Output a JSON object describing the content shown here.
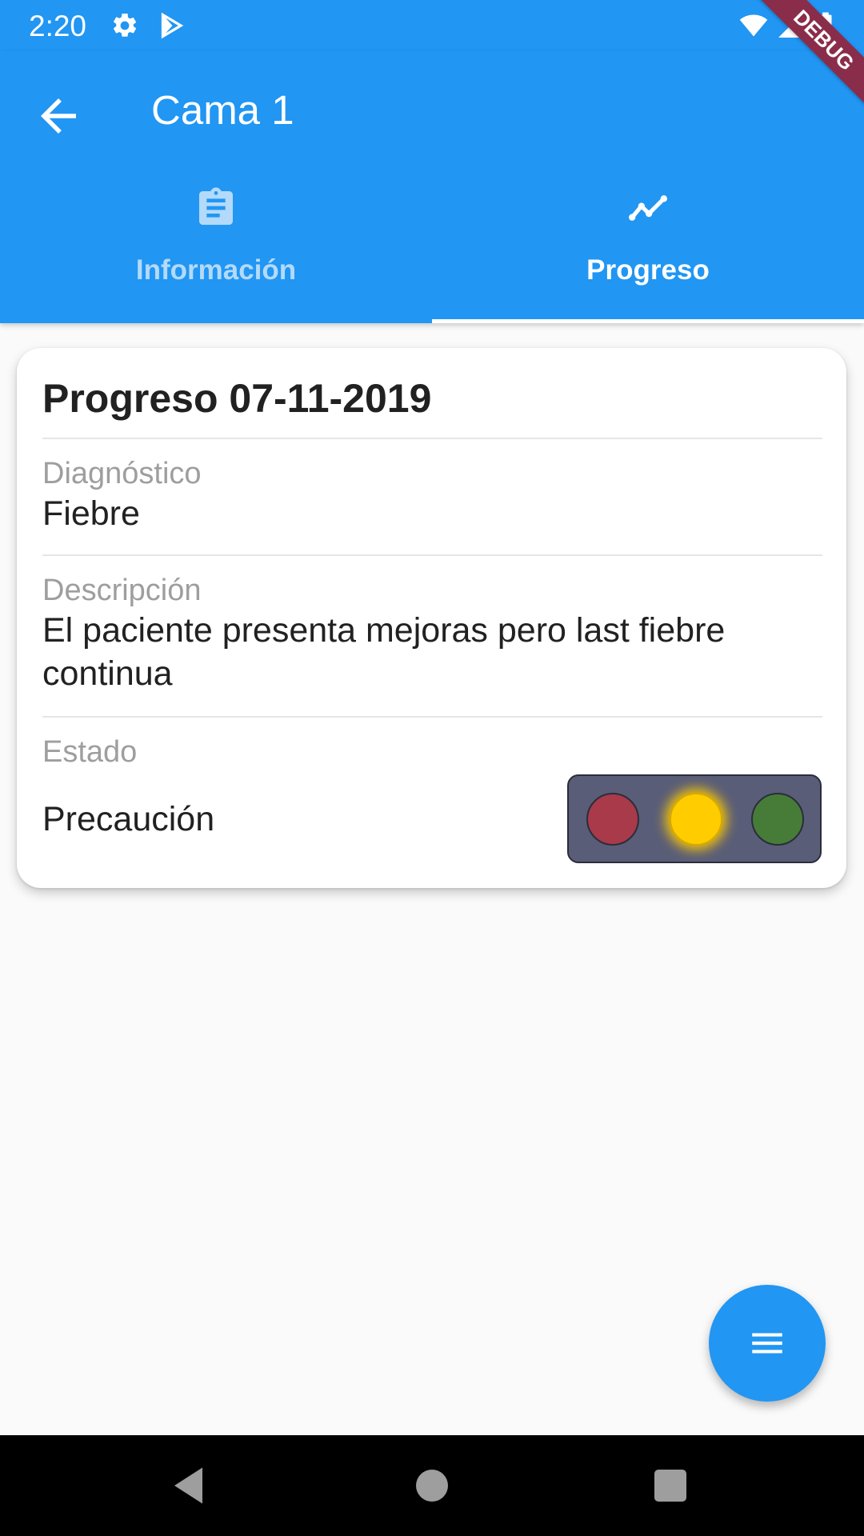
{
  "status_bar": {
    "time": "2:20",
    "icons": [
      "settings-icon",
      "play-store-icon",
      "wifi-icon",
      "signal-icon",
      "battery-icon"
    ]
  },
  "app_bar": {
    "title": "Cama 1",
    "back_icon": "arrow-back-icon"
  },
  "tabs": [
    {
      "label": "Información",
      "icon": "clipboard-icon",
      "selected": false
    },
    {
      "label": "Progreso",
      "icon": "trending-icon",
      "selected": true
    }
  ],
  "card": {
    "title": "Progreso 07-11-2019",
    "diagnosis_label": "Diagnóstico",
    "diagnosis_value": "Fiebre",
    "description_label": "Descripción",
    "description_value": "El paciente presenta mejoras pero last fiebre continua",
    "status_label": "Estado",
    "status_value": "Precaución",
    "traffic_light": {
      "active": "yellow",
      "colors": {
        "red": "#a83a4a",
        "yellow": "#ffcc00",
        "green": "#467c38",
        "housing": "#5a5d78"
      }
    }
  },
  "debug_banner": "DEBUG",
  "fab": {
    "icon": "menu-icon"
  },
  "colors": {
    "primary": "#2196f3",
    "background": "#fafafa"
  }
}
